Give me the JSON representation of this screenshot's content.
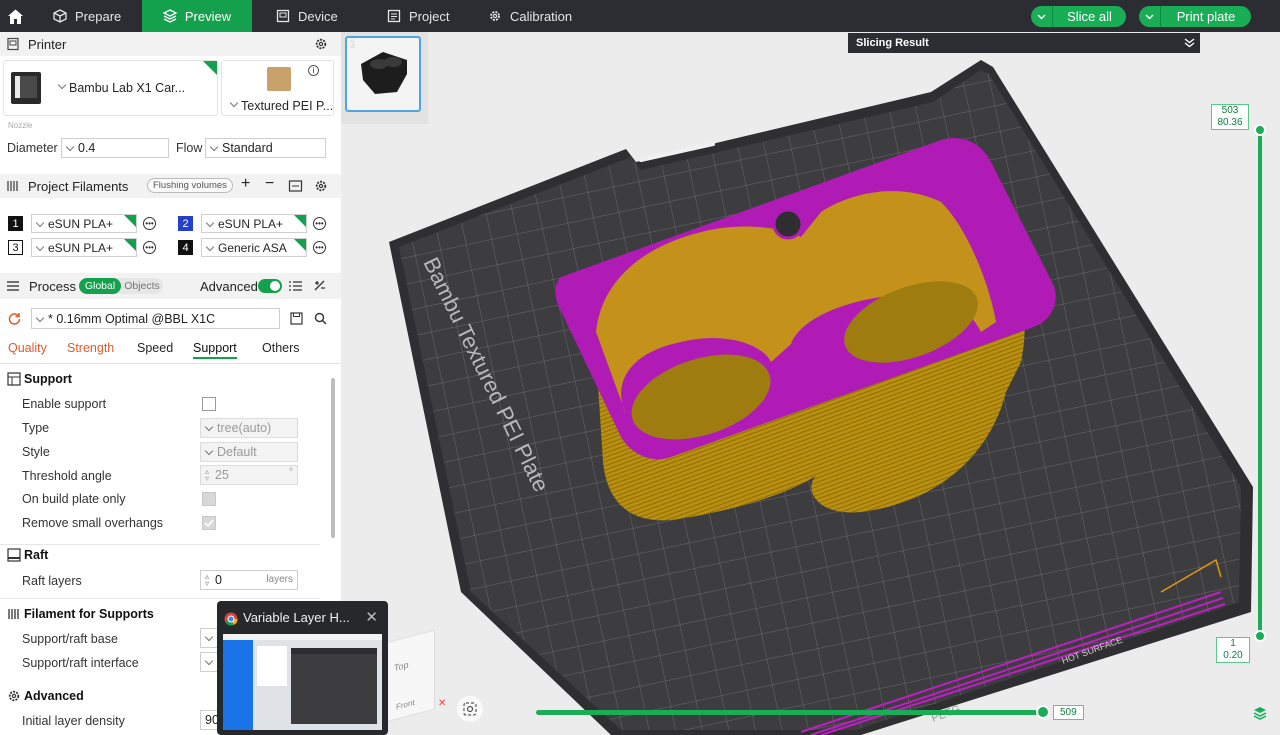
{
  "topbar": {
    "tabs": [
      {
        "label": "Prepare",
        "icon": "cube-icon"
      },
      {
        "label": "Preview",
        "icon": "layers-icon"
      },
      {
        "label": "Device",
        "icon": "device-icon"
      },
      {
        "label": "Project",
        "icon": "project-icon"
      },
      {
        "label": "Calibration",
        "icon": "gear-icon"
      }
    ],
    "slice_all": "Slice all",
    "print_plate": "Print plate",
    "accent_color": "#14a14e"
  },
  "printer": {
    "section_title": "Printer",
    "printer_name": "Bambu Lab X1 Car...",
    "plate_name": "Textured PEI P...",
    "nozzle_label": "Nozzle",
    "diameter_label": "Diameter",
    "diameter_value": "0.4",
    "flow_label": "Flow",
    "flow_value": "Standard"
  },
  "filaments": {
    "section_title": "Project Filaments",
    "flushing_button": "Flushing volumes",
    "items": [
      {
        "num": "1",
        "name": "eSUN PLA+",
        "color": "#111111"
      },
      {
        "num": "2",
        "name": "eSUN PLA+",
        "color": "#2440c8"
      },
      {
        "num": "3",
        "name": "eSUN PLA+",
        "color": "#ffffff"
      },
      {
        "num": "4",
        "name": "Generic ASA",
        "color": "#111111"
      }
    ]
  },
  "process": {
    "section_title": "Process",
    "global_label": "Global",
    "objects_label": "Objects",
    "advanced_label": "Advanced",
    "preset": "* 0.16mm Optimal @BBL X1C",
    "tabs": [
      "Quality",
      "Strength",
      "Speed",
      "Support",
      "Others"
    ],
    "active_tab": "Support"
  },
  "support": {
    "title": "Support",
    "enable_label": "Enable support",
    "type_label": "Type",
    "type_value": "tree(auto)",
    "style_label": "Style",
    "style_value": "Default",
    "threshold_label": "Threshold angle",
    "threshold_value": "25",
    "threshold_unit": "°",
    "build_plate_label": "On build plate only",
    "remove_small_label": "Remove small overhangs"
  },
  "raft": {
    "title": "Raft",
    "layers_label": "Raft layers",
    "layers_value": "0",
    "layers_unit": "layers"
  },
  "filament_supports": {
    "title": "Filament for Supports",
    "base_label": "Support/raft base",
    "interface_label": "Support/raft interface"
  },
  "advanced": {
    "title": "Advanced",
    "density_label": "Initial layer density",
    "density_value": "90"
  },
  "viewport": {
    "slicing_result": "Slicing Result",
    "plate_text": "Bambu Textured PEI Plate",
    "thumb_number": "1",
    "layer_top_number": "503",
    "layer_top_height": "80.36",
    "layer_bottom_number": "1",
    "layer_bottom_height": "0.20",
    "horizontal_value": "509",
    "hot_surface": "HOT SURFACE",
    "petg_text": "PETG",
    "cube_top": "Top",
    "cube_front": "Front"
  },
  "popup": {
    "title": "Variable Layer H..."
  }
}
